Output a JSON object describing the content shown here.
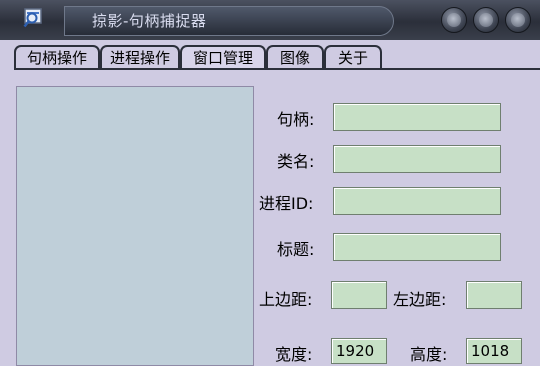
{
  "window": {
    "title": "掠影-句柄捕捉器"
  },
  "tabs": [
    {
      "label": "句柄操作"
    },
    {
      "label": "进程操作"
    },
    {
      "label": "窗口管理"
    },
    {
      "label": "图像"
    },
    {
      "label": "关于"
    }
  ],
  "fields": {
    "handle_label": "句柄:",
    "handle_value": "",
    "class_label": "类名:",
    "class_value": "",
    "pid_label": "进程ID:",
    "pid_value": "",
    "title_label": "标题:",
    "title_value": "",
    "top_label": "上边距:",
    "top_value": "",
    "left_label": "左边距:",
    "left_value": "",
    "width_label": "宽度:",
    "width_value": "1920",
    "height_label": "高度:",
    "height_value": "1018"
  },
  "colors": {
    "field_bg": "#c7e0c6",
    "panel_bg": "#bfcfd9",
    "window_bg": "#cfcbe2",
    "titlebar": "#2b2f3a"
  }
}
